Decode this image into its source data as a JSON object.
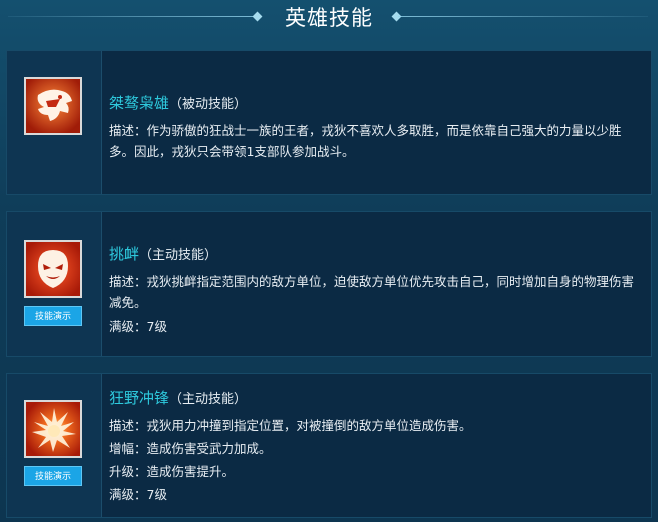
{
  "header": {
    "title": "英雄技能"
  },
  "skills": [
    {
      "name": "桀骜枭雄",
      "type": "（被动技能）",
      "description": "描述：作为骄傲的狂战士一族的王者，戎狄不喜欢人多取胜，而是依靠自己强大的力量以少胜多。因此，戎狄只会带领1支部队参加战斗。",
      "icon": "beast-roar-icon",
      "demo_label": null
    },
    {
      "name": "挑衅",
      "type": "（主动技能）",
      "description": "描述：戎狄挑衅指定范围内的敌方单位，迫使敌方单位优先攻击自己，同时增加自身的物理伤害减免。",
      "extra": [
        "满级：7级"
      ],
      "icon": "mask-face-icon",
      "demo_label": "技能演示"
    },
    {
      "name": "狂野冲锋",
      "type": "（主动技能）",
      "description": "描述：戎狄用力冲撞到指定位置，对被撞倒的敌方单位造成伤害。",
      "extra": [
        "增幅：造成伤害受武力加成。",
        "升级：造成伤害提升。",
        "满级：7级"
      ],
      "icon": "burst-charge-icon",
      "demo_label": "技能演示"
    }
  ],
  "colors": {
    "accent": "#2ec9dd",
    "button": "#1ba5e6",
    "icon_red": "#c42a12",
    "card_bg": "#0b2a44"
  }
}
